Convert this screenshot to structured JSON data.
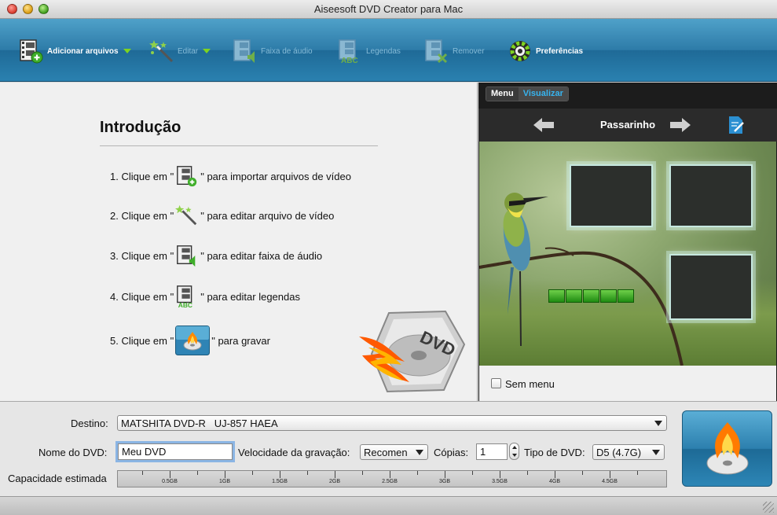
{
  "window": {
    "title": "Aiseesoft DVD Creator para Mac"
  },
  "toolbar": {
    "add_files": "Adicionar arquivos",
    "edit": "Editar",
    "audio_track": "Faixa de áudio",
    "subtitles": "Legendas",
    "remove": "Remover",
    "preferences": "Preferências"
  },
  "intro": {
    "title": "Introdução",
    "steps": [
      {
        "before": "1. Clique em \"",
        "after": "\" para importar arquivos de vídeo"
      },
      {
        "before": "2. Clique em \"",
        "after": "\" para editar arquivo de vídeo"
      },
      {
        "before": "3. Clique em \"",
        "after": "\" para editar faixa de áudio"
      },
      {
        "before": "4. Clique em \"",
        "after": "\" para editar legendas"
      },
      {
        "before": "5. Clique em \"",
        "after": "\" para gravar"
      }
    ]
  },
  "preview": {
    "tab_menu": "Menu",
    "tab_preview": "Visualizar",
    "template_name": "Passarinho",
    "no_menu_label": "Sem menu",
    "accent_color": "#37b4ef"
  },
  "options": {
    "destination_label": "Destino:",
    "destination_value": "MATSHITA DVD-R   UJ-857 HAEA",
    "dvd_name_label": "Nome do DVD:",
    "dvd_name_value": "Meu DVD",
    "speed_label": "Velocidade da gravação:",
    "speed_value": "Recomen",
    "copies_label": "Cópias:",
    "copies_value": "1",
    "dvd_type_label": "Tipo de DVD:",
    "dvd_type_value": "D5 (4.7G)",
    "capacity_label": "Capacidade estimada",
    "capacity_ticks": [
      "0.5GB",
      "1GB",
      "1.5GB",
      "2GB",
      "2.5GB",
      "3GB",
      "3.5GB",
      "4GB",
      "4.5GB"
    ]
  }
}
